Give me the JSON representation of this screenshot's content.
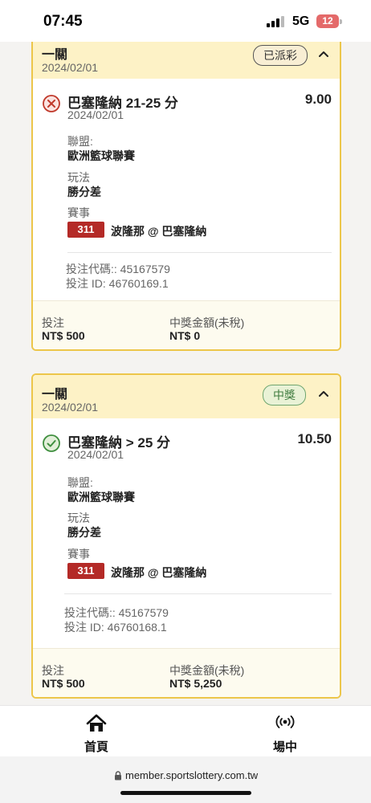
{
  "status_bar": {
    "time": "07:45",
    "network": "5G",
    "battery": "12"
  },
  "bets": [
    {
      "type": "一關",
      "date": "2024/02/01",
      "status": "已派彩",
      "result": "lost",
      "selection": "巴塞隆納 21-25 分",
      "odds": "9.00",
      "selection_date": "2024/02/01",
      "league_label": "聯盟:",
      "league": "歐洲籃球聯賽",
      "market_label": "玩法",
      "market": "勝分差",
      "event_label": "賽事",
      "event_no": "311",
      "event_name": "波隆那 @ 巴塞隆納",
      "bet_code": "投注代碼:: 45167579",
      "bet_id": "投注 ID: 46760169.1",
      "stake_label": "投注",
      "stake": "NT$ 500",
      "payout_label": "中獎金額(未稅)",
      "payout": "NT$ 0"
    },
    {
      "type": "一關",
      "date": "2024/02/01",
      "status": "中獎",
      "result": "won",
      "selection": "巴塞隆納 > 25 分",
      "odds": "10.50",
      "selection_date": "2024/02/01",
      "league_label": "聯盟:",
      "league": "歐洲籃球聯賽",
      "market_label": "玩法",
      "market": "勝分差",
      "event_label": "賽事",
      "event_no": "311",
      "event_name": "波隆那 @ 巴塞隆納",
      "bet_code": "投注代碼:: 45167579",
      "bet_id": "投注 ID: 46760168.1",
      "stake_label": "投注",
      "stake": "NT$ 500",
      "payout_label": "中獎金額(未稅)",
      "payout": "NT$ 5,250"
    }
  ],
  "nav": [
    {
      "label": "首頁",
      "icon": "home-icon"
    },
    {
      "label": "場中",
      "icon": "live-broadcast-icon"
    }
  ],
  "browser": {
    "url": "member.sportslottery.com.tw"
  },
  "colors": {
    "card_border": "#ecc64a",
    "card_header_bg": "#fdf2c6",
    "lost_red": "#c0392b",
    "win_green": "#3f8f3f",
    "event_badge": "#b42a27"
  }
}
